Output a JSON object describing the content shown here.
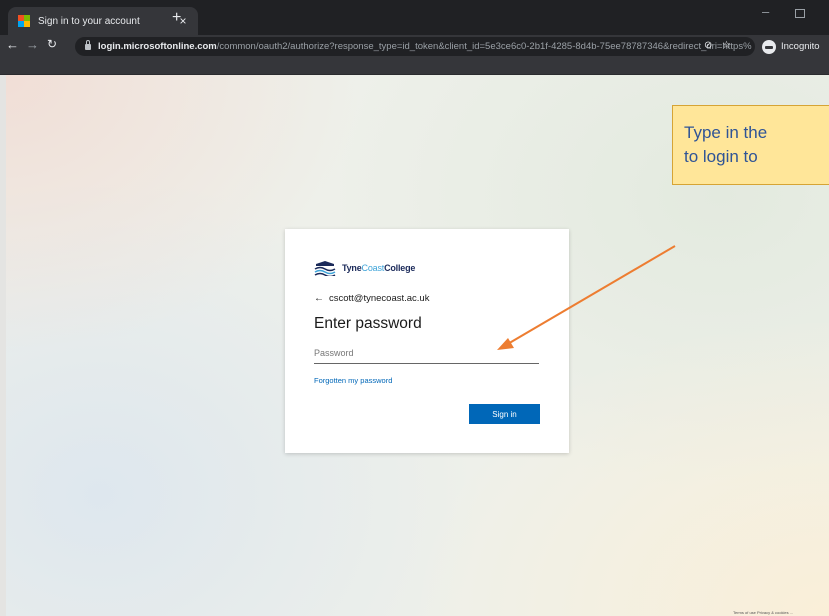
{
  "browser": {
    "tab_title": "Sign in to your account",
    "tab_close": "×",
    "new_tab": "+",
    "minimize": "–",
    "url_host": "login.microsoftonline.com",
    "url_path": "/common/oauth2/authorize?response_type=id_token&client_id=5e3ce6c0-2b1f-4285-8d4b-75ee78787346&redirect_uri=https%",
    "incognito_label": "Incognito"
  },
  "signin": {
    "logo_tyne": "Tyne",
    "logo_coast": "Coast",
    "logo_college": "College",
    "back_arrow": "←",
    "identity": "cscott@tynecoast.ac.uk",
    "heading": "Enter password",
    "password_placeholder": "Password",
    "forgot_link": "Forgotten my password",
    "signin_button": "Sign in"
  },
  "callout": {
    "line1": "Type in the",
    "line2": "to login to"
  },
  "footer": {
    "text": "Terms of use   Privacy & cookies   ..."
  },
  "colors": {
    "accent": "#0067b8",
    "callout_fill": "#ffe699",
    "arrow": "#ed7d31"
  }
}
